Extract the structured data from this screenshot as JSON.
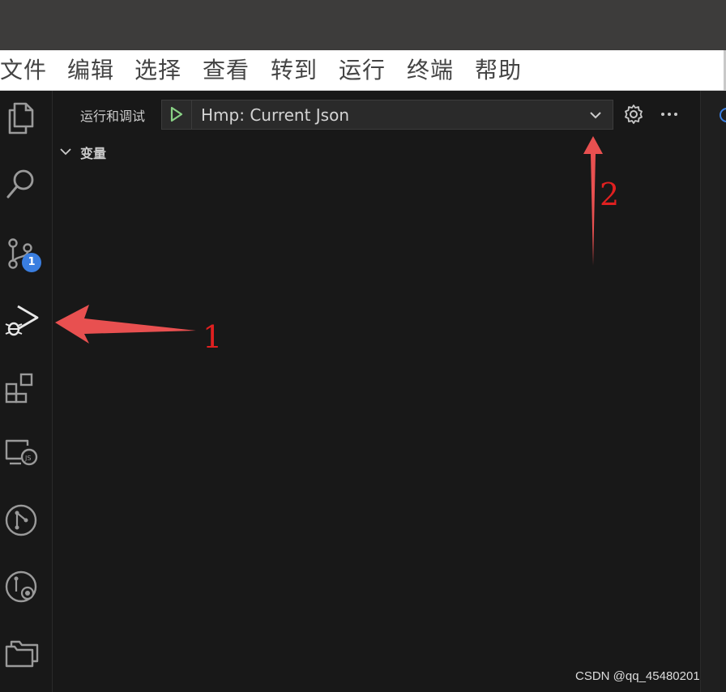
{
  "menu": {
    "items": [
      "文件",
      "编辑",
      "选择",
      "查看",
      "转到",
      "运行",
      "终端",
      "帮助"
    ]
  },
  "activity_bar": {
    "items": [
      {
        "name": "explorer",
        "icon": "files-icon"
      },
      {
        "name": "search",
        "icon": "search-icon"
      },
      {
        "name": "source-control",
        "icon": "source-control-icon",
        "badge": "1"
      },
      {
        "name": "run-and-debug",
        "icon": "run-debug-icon",
        "active": true
      },
      {
        "name": "extensions",
        "icon": "extensions-icon"
      },
      {
        "name": "remote-explorer",
        "icon": "remote-explorer-icon"
      },
      {
        "name": "git-graph",
        "icon": "git-graph-icon"
      },
      {
        "name": "git-history",
        "icon": "git-history-icon"
      },
      {
        "name": "project-manager",
        "icon": "folders-icon"
      }
    ]
  },
  "run_debug": {
    "title": "运行和调试",
    "config_name": "Hmp: Current Json",
    "section": "变量"
  },
  "annotations": {
    "label_1": "1",
    "label_2": "2",
    "color": "#e85050"
  },
  "watermark": "CSDN @qq_45480201",
  "colors": {
    "background": "#181818",
    "titlebar": "#3d3c3b",
    "menubar": "#ffffff",
    "accent_badge": "#3a7ee0",
    "play_green": "#89d185"
  }
}
